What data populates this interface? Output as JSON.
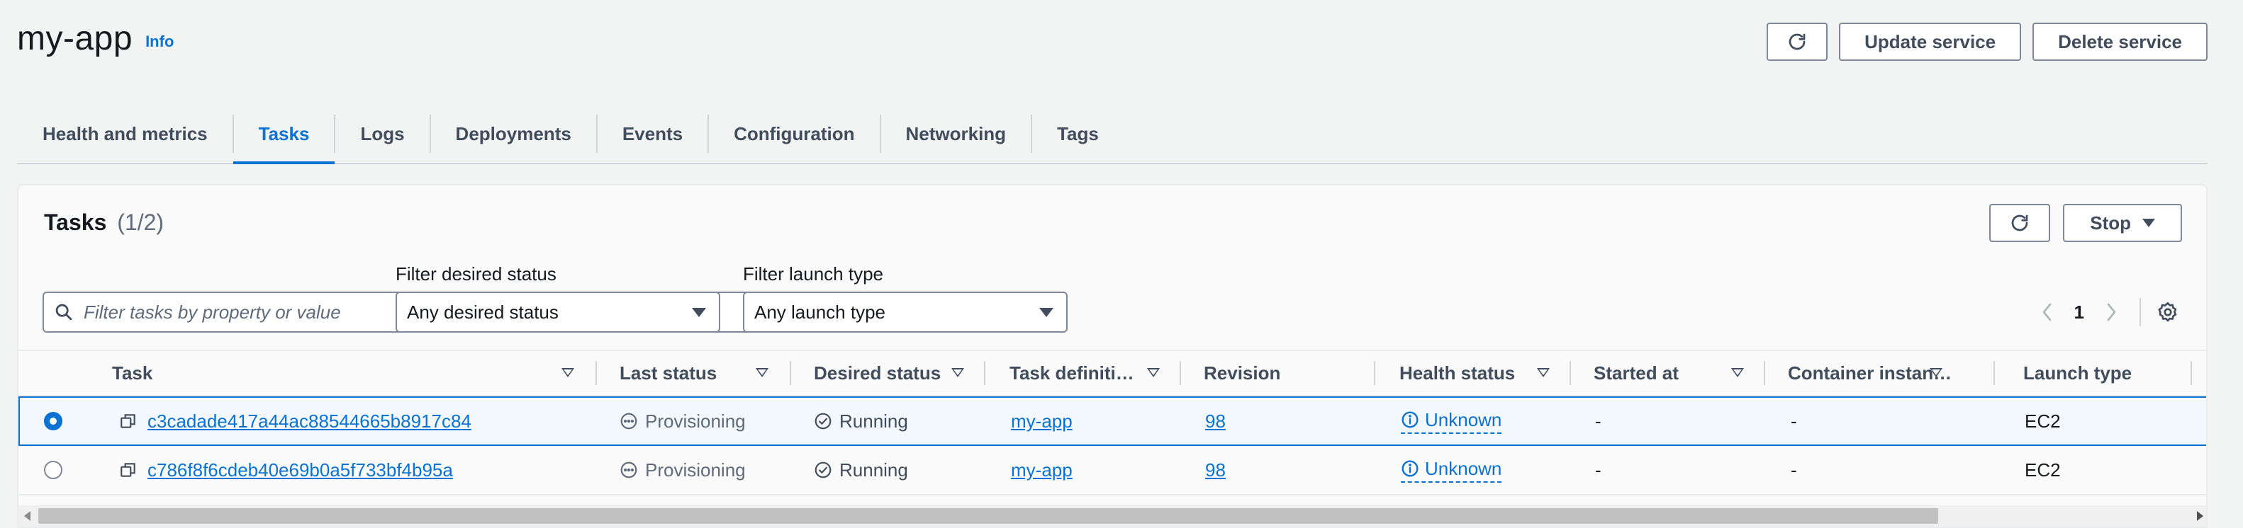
{
  "page": {
    "title": "my-app",
    "info_label": "Info"
  },
  "header_actions": {
    "update_label": "Update service",
    "delete_label": "Delete service"
  },
  "tabs": [
    {
      "label": "Health and metrics",
      "active": false
    },
    {
      "label": "Tasks",
      "active": true
    },
    {
      "label": "Logs",
      "active": false
    },
    {
      "label": "Deployments",
      "active": false
    },
    {
      "label": "Events",
      "active": false
    },
    {
      "label": "Configuration",
      "active": false
    },
    {
      "label": "Networking",
      "active": false
    },
    {
      "label": "Tags",
      "active": false
    }
  ],
  "tasks_panel": {
    "title": "Tasks",
    "count": "(1/2)",
    "stop_label": "Stop",
    "search_placeholder": "Filter tasks by property or value",
    "filter_desired": {
      "label": "Filter desired status",
      "value": "Any desired status"
    },
    "filter_launch": {
      "label": "Filter launch type",
      "value": "Any launch type"
    },
    "page_number": "1"
  },
  "columns": [
    "Task",
    "Last status",
    "Desired status",
    "Task definiti…",
    "Revision",
    "Health status",
    "Started at",
    "Container instan…",
    "Launch type"
  ],
  "rows": [
    {
      "selected": true,
      "task": "c3cadade417a44ac88544665b8917c84",
      "last_status": "Provisioning",
      "desired_status": "Running",
      "task_definition": "my-app",
      "revision": "98",
      "health": "Unknown",
      "started_at": "-",
      "container_instance": "-",
      "launch_type": "EC2"
    },
    {
      "selected": false,
      "task": "c786f8f6cdeb40e69b0a5f733bf4b95a",
      "last_status": "Provisioning",
      "desired_status": "Running",
      "task_definition": "my-app",
      "revision": "98",
      "health": "Unknown",
      "started_at": "-",
      "container_instance": "-",
      "launch_type": "EC2"
    }
  ],
  "colors": {
    "accent": "#0972d3",
    "text": "#16191f",
    "muted": "#5f6b7a",
    "background": "#f2f3f3"
  }
}
